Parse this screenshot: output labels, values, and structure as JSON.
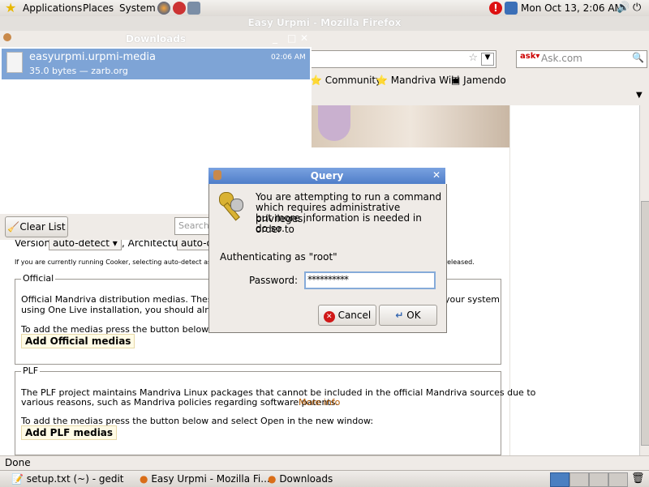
{
  "top_panel": {
    "menus": [
      "Applications",
      "Places",
      "System"
    ],
    "clock": "Mon Oct 13,  2:06 AM"
  },
  "firefox": {
    "title": "Easy Urpmi - Mozilla Firefox",
    "search_placeholder": "Ask.com",
    "bookmarks": [
      "Community",
      "Mandriva Wiki",
      "Jamendo"
    ],
    "status": "Done"
  },
  "downloads": {
    "title": "Downloads",
    "item": {
      "name": "easyurpmi.urpmi-media",
      "detail": "35.0 bytes — zarb.org",
      "time": "02:06 AM"
    },
    "clear_label": "Clear List",
    "search_placeholder": "Search..."
  },
  "page": {
    "version_label": "Version:",
    "version_value": "auto-detect",
    "arch_label": ", Architecture:",
    "arch_value": "auto-d",
    "cooker_note": "If you are currently running Cooker, selecting auto-detect as Ve",
    "released": "released.",
    "official": {
      "legend": "Official",
      "text1": "Official Mandriva distribution medias. These are t",
      "text1_end": "your system",
      "text2": "using One Live installation, you should already h",
      "instruction": "To add the medias press the button below and s",
      "button": "Add Official medias"
    },
    "plf": {
      "legend": "PLF",
      "text1": "The PLF project maintains Mandriva Linux packages that cannot be included in the official Mandriva sources due to",
      "text2": "various reasons, such as Mandriva policies regarding software patents.",
      "more": "More info",
      "instruction": "To add the medias press the button below and select Open in the new window:",
      "button": "Add PLF medias"
    }
  },
  "query": {
    "title": "Query",
    "message_lines": [
      "You are attempting to run a command",
      "which requires administrative privileges,",
      "but more information is needed in order to",
      "do so."
    ],
    "auth": "Authenticating as \"root\"",
    "password_label": "Password:",
    "password_value": "**********",
    "cancel": "Cancel",
    "ok": "OK"
  },
  "taskbar": {
    "tasks": [
      "setup.txt (~) - gedit",
      "Easy Urpmi - Mozilla Fi...",
      "Downloads"
    ]
  }
}
